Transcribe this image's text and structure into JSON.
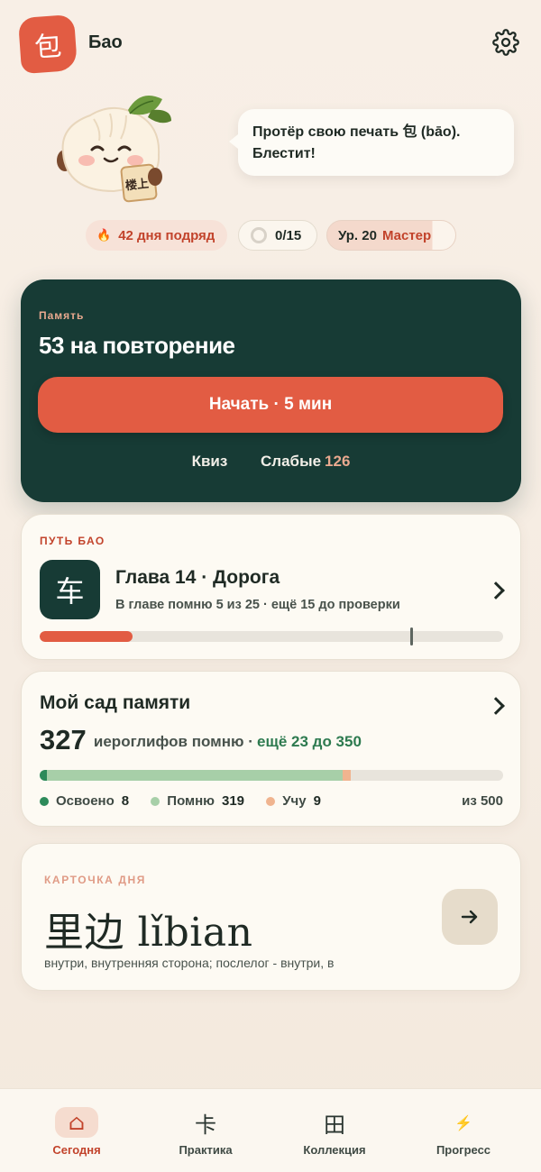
{
  "header": {
    "logo_glyph": "包",
    "app_name": "Бао",
    "settings_icon": "gear-icon"
  },
  "mascot": {
    "sign_text": "楼上",
    "speech": "Протёр свою печать 包 (bāo). Блестит!"
  },
  "stats": {
    "streak_icon": "🔥",
    "streak_label": "42 дня подряд",
    "goal_label": "0/15",
    "goal_progress": 0,
    "level_label": "Ур. 20",
    "level_title": "Мастер",
    "level_progress": 0.82
  },
  "memory": {
    "label": "Память",
    "title": "53 на повторение",
    "start_button": "Начать · 5 мин",
    "quiz_link": "Квиз",
    "weak_link": "Слабые",
    "weak_count": "126"
  },
  "path": {
    "label": "ПУТЬ БАО",
    "chapter_glyph": "车",
    "chapter_title": "Глава 14 · Дорога",
    "chapter_subtitle": "В главе помню 5 из 25 · ещё 15 до проверки",
    "progress": 0.2,
    "checkpoint": 0.8
  },
  "garden": {
    "title": "Мой сад памяти",
    "count": "327",
    "count_label": "иероглифов помню ·",
    "goal_text": "ещё 23 до 350",
    "segments": [
      {
        "name": "mastered",
        "value": 8,
        "color": "#2d8a5a"
      },
      {
        "name": "remember",
        "value": 319,
        "color": "#a7cfa8"
      },
      {
        "name": "learning",
        "value": 9,
        "color": "#f0b48f"
      }
    ],
    "total_value": 500,
    "legend": [
      {
        "label": "Освоено",
        "value": "8",
        "color": "#2d8a5a"
      },
      {
        "label": "Помню",
        "value": "319",
        "color": "#a7cfa8"
      },
      {
        "label": "Учу",
        "value": "9",
        "color": "#f0b48f"
      }
    ],
    "total_text": "из 500"
  },
  "card_of_day": {
    "label": "КАРТОЧКА ДНЯ",
    "word": "里边 lǐbian",
    "meaning": "внутри, внутренняя сторона; послелог - внутри, в"
  },
  "tabs": [
    {
      "icon": "⌂",
      "label": "Сегодня",
      "active": true
    },
    {
      "icon": "卡",
      "label": "Практика",
      "active": false
    },
    {
      "icon": "田",
      "label": "Коллекция",
      "active": false
    },
    {
      "icon": "⚡",
      "label": "Прогресс",
      "active": false
    }
  ],
  "colors": {
    "accent": "#e25c43",
    "dark_green": "#173b35",
    "background": "#f8efe6"
  }
}
